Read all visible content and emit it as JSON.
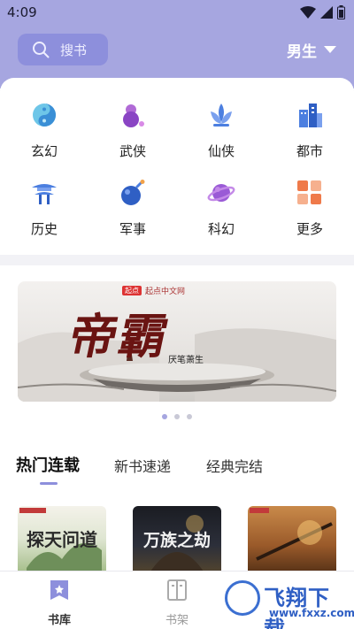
{
  "status_bar": {
    "time": "4:09"
  },
  "header": {
    "search_label": "搜书",
    "gender": "男生"
  },
  "categories": [
    {
      "label": "玄幻",
      "icon": "yin-yang-icon"
    },
    {
      "label": "武侠",
      "icon": "gourd-icon"
    },
    {
      "label": "仙侠",
      "icon": "lotus-icon"
    },
    {
      "label": "都市",
      "icon": "city-buildings-icon"
    },
    {
      "label": "历史",
      "icon": "pagoda-icon"
    },
    {
      "label": "军事",
      "icon": "bomb-icon"
    },
    {
      "label": "科幻",
      "icon": "planet-icon"
    },
    {
      "label": "更多",
      "icon": "grid-icon"
    }
  ],
  "banner": {
    "logo_badge": "起点",
    "logo_text": "起点中文网",
    "title": "帝霸",
    "author": "厌笔萧生",
    "page_count": 3,
    "active_page": 0
  },
  "tabs": [
    {
      "label": "热门连载",
      "active": true
    },
    {
      "label": "新书速递",
      "active": false
    },
    {
      "label": "经典完结",
      "active": false
    }
  ],
  "books": [
    {
      "cover_title": "探天问道"
    },
    {
      "cover_title": "万族之劫"
    },
    {
      "cover_title": ""
    }
  ],
  "bottom_nav": [
    {
      "label": "书库",
      "active": true,
      "icon": "library-icon"
    },
    {
      "label": "书架",
      "active": false,
      "icon": "bookshelf-icon"
    }
  ],
  "watermark": {
    "text": "飞翔下载",
    "url": "www.fxxz.com"
  },
  "colors": {
    "header_bg": "#a6a6e0",
    "search_bg": "#8d8fdc",
    "accent": "#8d8fdc",
    "page_bg": "#f2f2f6"
  }
}
